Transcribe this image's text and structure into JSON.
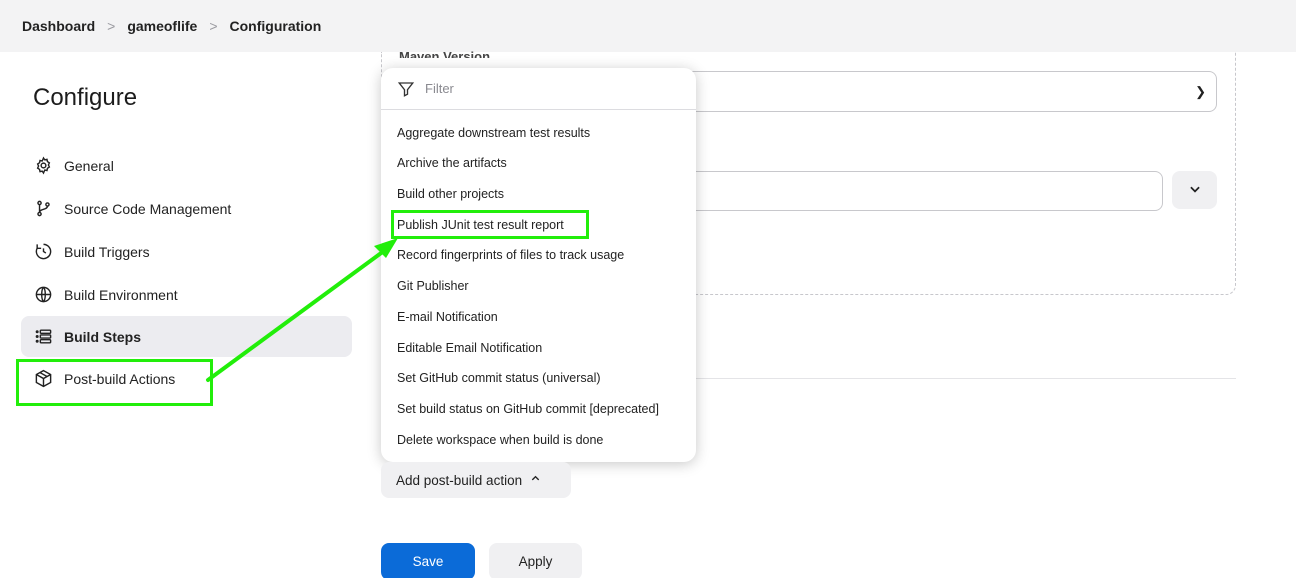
{
  "breadcrumb": {
    "items": [
      "Dashboard",
      "gameoflife",
      "Configuration"
    ],
    "separator": ">"
  },
  "sidebar": {
    "title": "Configure",
    "items": [
      {
        "label": "General",
        "icon": "gear-icon"
      },
      {
        "label": "Source Code Management",
        "icon": "branch-icon"
      },
      {
        "label": "Build Triggers",
        "icon": "clock-icon"
      },
      {
        "label": "Build Environment",
        "icon": "globe-icon"
      },
      {
        "label": "Build Steps",
        "icon": "list-icon",
        "active": true
      },
      {
        "label": "Post-build Actions",
        "icon": "package-icon"
      }
    ]
  },
  "main": {
    "maven_label": "Maven Version"
  },
  "dropdown": {
    "filter_placeholder": "Filter",
    "items": [
      "Aggregate downstream test results",
      "Archive the artifacts",
      "Build other projects",
      "Publish JUnit test result report",
      "Record fingerprints of files to track usage",
      "Git Publisher",
      "E-mail Notification",
      "Editable Email Notification",
      "Set GitHub commit status (universal)",
      "Set build status on GitHub commit [deprecated]",
      "Delete workspace when build is done"
    ],
    "highlighted": "Publish JUnit test result report"
  },
  "actions": {
    "add_post_build": "Add post-build action",
    "save": "Save",
    "apply": "Apply"
  },
  "colors": {
    "highlight": "#22ee0a",
    "primary": "#0b6bd8"
  }
}
